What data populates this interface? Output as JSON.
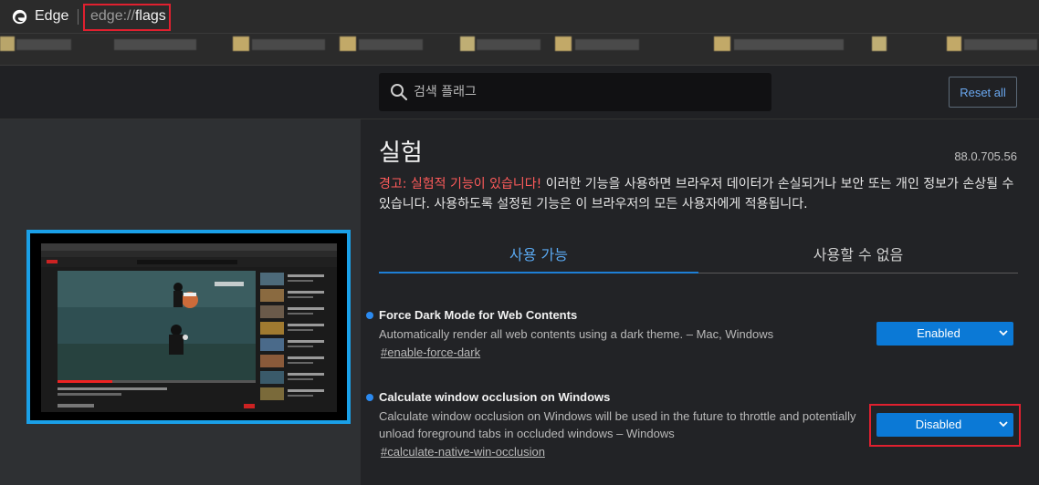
{
  "browser": {
    "app_name": "Edge",
    "url_scheme": "edge://",
    "url_host": "flags"
  },
  "search": {
    "placeholder": "검색 플래그"
  },
  "reset_all_label": "Reset all",
  "page": {
    "title": "실험",
    "version": "88.0.705.56",
    "warning_lead": "경고: 실험적 기능이 있습니다!",
    "warning_body": " 이러한 기능을 사용하면 브라우저 데이터가 손실되거나 보안 또는 개인 정보가 손상될 수 있습니다. 사용하도록 설정된 기능은 이 브라우저의 모든 사용자에게 적용됩니다."
  },
  "tabs": {
    "available": "사용 가능",
    "unavailable": "사용할 수 없음"
  },
  "flags": [
    {
      "title": "Force Dark Mode for Web Contents",
      "description": "Automatically render all web contents using a dark theme. – Mac, Windows",
      "link": "#enable-force-dark",
      "value": "Enabled"
    },
    {
      "title": "Calculate window occlusion on Windows",
      "description": "Calculate window occlusion on Windows will be used in the future to throttle and potentially unload foreground tabs in occluded windows – Windows",
      "link": "#calculate-native-win-occlusion",
      "value": "Disabled"
    }
  ],
  "colors": {
    "accent": "#0b79d6",
    "warning": "#ff5b5b",
    "highlight": "#e0202f",
    "preview_frame": "#1aa0e8"
  }
}
